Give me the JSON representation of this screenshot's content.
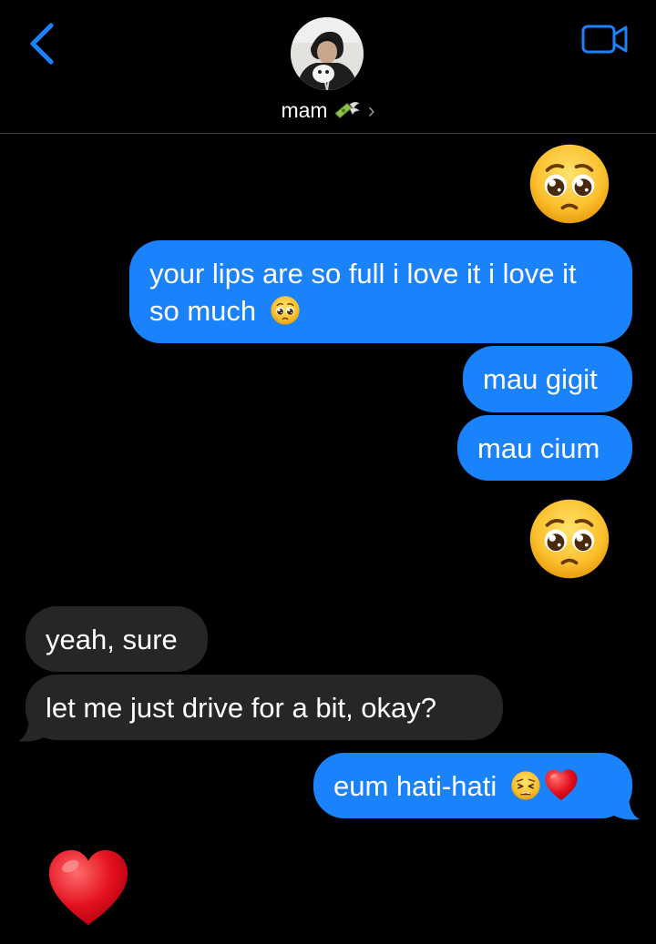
{
  "header": {
    "contact_name": "mam",
    "name_emoji": "money-with-wings-emoji",
    "chevron": "›"
  },
  "messages": [
    {
      "from": "me",
      "kind": "emoji",
      "emoji": "pleading-face-emoji"
    },
    {
      "from": "me",
      "kind": "text",
      "text": "your lips are so full i love it i love it so much",
      "emoji": "pleading-face-emoji"
    },
    {
      "from": "me",
      "kind": "text",
      "text": "mau gigit"
    },
    {
      "from": "me",
      "kind": "text",
      "text": "mau cium"
    },
    {
      "from": "me",
      "kind": "emoji",
      "emoji": "pleading-face-emoji"
    },
    {
      "from": "them",
      "kind": "text",
      "text": "yeah, sure"
    },
    {
      "from": "them",
      "kind": "text",
      "text": "let me just drive for a bit, okay?"
    },
    {
      "from": "me",
      "kind": "text",
      "text": "eum hati-hati",
      "emoji": "weary-face-emoji red-heart-emoji"
    },
    {
      "from": "them",
      "kind": "emoji",
      "emoji": "red-heart-emoji"
    }
  ],
  "colors": {
    "background": "#000000",
    "sent_bubble": "#1a82fb",
    "received_bubble": "#262628",
    "accent": "#1a82fb",
    "separator": "#3a3a3c"
  }
}
